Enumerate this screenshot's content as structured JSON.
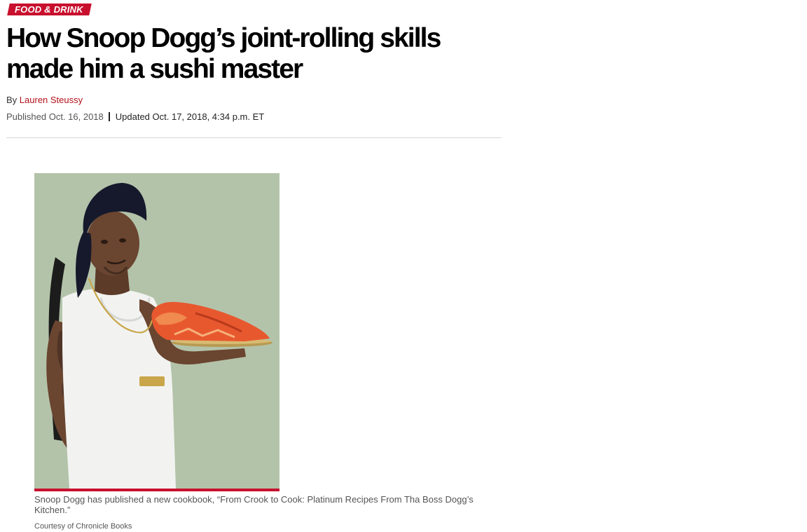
{
  "article": {
    "category": "FOOD & DRINK",
    "headline": "How Snoop Dogg’s joint-rolling skills made him a sushi master",
    "byline": {
      "prefix": "By",
      "author": "Lauren Steussy"
    },
    "published": "Published Oct. 16, 2018",
    "updated": "Updated Oct. 17, 2018, 4:34 p.m. ET",
    "image": {
      "caption": "Snoop Dogg has published a new cookbook, “From Crook to Cook: Platinum Recipes From Tha Boss Dogg’s Kitchen.”",
      "credit": "Courtesy of Chronicle Books"
    }
  },
  "colors": {
    "accent": "#c8102e",
    "author_link": "#b4121b",
    "photo_background": "#b3c3a9"
  }
}
